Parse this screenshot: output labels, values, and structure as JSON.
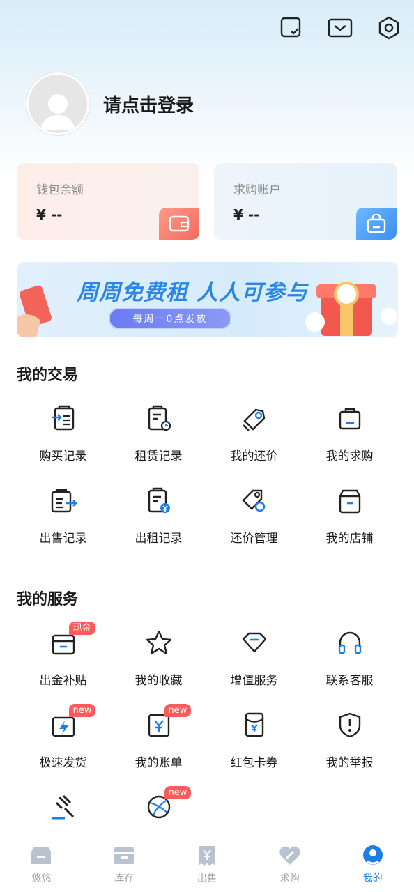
{
  "header": {
    "login_text": "请点击登录"
  },
  "wallet": {
    "label": "钱包余额",
    "value": "¥ --"
  },
  "purchase_account": {
    "label": "求购账户",
    "value": "¥ --"
  },
  "banner": {
    "title": "周周免费租 人人可参与",
    "subtitle": "每周一0点发放"
  },
  "trade": {
    "title": "我的交易",
    "items": [
      {
        "label": "购买记录",
        "icon": "purchase-record-icon"
      },
      {
        "label": "租赁记录",
        "icon": "rental-record-icon"
      },
      {
        "label": "我的还价",
        "icon": "counter-offer-icon"
      },
      {
        "label": "我的求购",
        "icon": "my-request-icon"
      },
      {
        "label": "出售记录",
        "icon": "sale-record-icon"
      },
      {
        "label": "出租记录",
        "icon": "lease-record-icon"
      },
      {
        "label": "还价管理",
        "icon": "offer-manage-icon"
      },
      {
        "label": "我的店铺",
        "icon": "store-icon"
      }
    ]
  },
  "service": {
    "title": "我的服务",
    "items": [
      {
        "label": "出金补贴",
        "icon": "subsidy-box-icon",
        "badge": "现金"
      },
      {
        "label": "我的收藏",
        "icon": "star-icon"
      },
      {
        "label": "增值服务",
        "icon": "diamond-icon"
      },
      {
        "label": "联系客服",
        "icon": "headset-icon"
      },
      {
        "label": "极速发货",
        "icon": "fast-ship-icon",
        "badge": "new"
      },
      {
        "label": "我的账单",
        "icon": "bill-icon",
        "badge": "new"
      },
      {
        "label": "红包卡券",
        "icon": "red-packet-icon"
      },
      {
        "label": "我的举报",
        "icon": "report-icon"
      },
      {
        "label": "",
        "icon": "gavel-icon"
      },
      {
        "label": "",
        "icon": "globe-icon",
        "badge": "new"
      }
    ]
  },
  "tabs": [
    {
      "label": "悠悠",
      "icon": "shop-tab-icon"
    },
    {
      "label": "库存",
      "icon": "inventory-tab-icon"
    },
    {
      "label": "出售",
      "icon": "sell-tab-icon"
    },
    {
      "label": "求购",
      "icon": "request-tab-icon"
    },
    {
      "label": "我的",
      "icon": "mine-tab-icon",
      "active": true
    }
  ],
  "colors": {
    "accent": "#1e7ee8",
    "badge": "#ff5a5a",
    "inactive_tab": "#9aa3ad"
  }
}
